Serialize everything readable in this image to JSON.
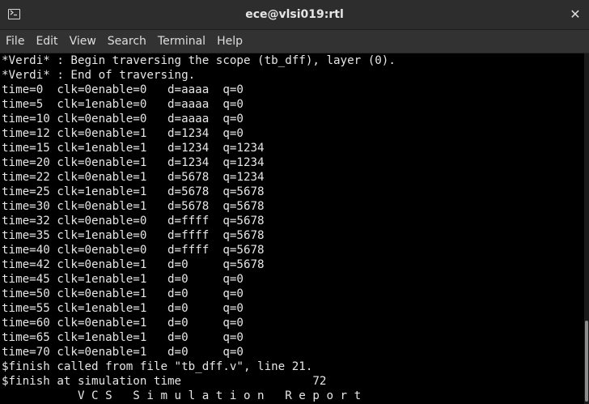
{
  "window": {
    "title": "ece@vlsi019:rtl",
    "close_glyph": "✕"
  },
  "icons": {
    "app": "terminal-icon",
    "close": "close-icon"
  },
  "menu": [
    {
      "label": "File"
    },
    {
      "label": "Edit"
    },
    {
      "label": "View"
    },
    {
      "label": "Search"
    },
    {
      "label": "Terminal"
    },
    {
      "label": "Help"
    }
  ],
  "terminal": {
    "lines": [
      "*Verdi* : Begin traversing the scope (tb_dff), layer (0).",
      "*Verdi* : End of traversing.",
      "time=0  clk=0enable=0   d=aaaa  q=0",
      "time=5  clk=1enable=0   d=aaaa  q=0",
      "time=10 clk=0enable=0   d=aaaa  q=0",
      "time=12 clk=0enable=1   d=1234  q=0",
      "time=15 clk=1enable=1   d=1234  q=1234",
      "time=20 clk=0enable=1   d=1234  q=1234",
      "time=22 clk=0enable=1   d=5678  q=1234",
      "time=25 clk=1enable=1   d=5678  q=5678",
      "time=30 clk=0enable=1   d=5678  q=5678",
      "time=32 clk=0enable=0   d=ffff  q=5678",
      "time=35 clk=1enable=0   d=ffff  q=5678",
      "time=40 clk=0enable=0   d=ffff  q=5678",
      "time=42 clk=0enable=1   d=0     q=5678",
      "time=45 clk=1enable=1   d=0     q=0",
      "time=50 clk=0enable=1   d=0     q=0",
      "time=55 clk=1enable=1   d=0     q=0",
      "time=60 clk=0enable=1   d=0     q=0",
      "time=65 clk=1enable=1   d=0     q=0",
      "time=70 clk=0enable=1   d=0     q=0",
      "$finish called from file \"tb_dff.v\", line 21.",
      "$finish at simulation time                   72",
      "           V C S   S i m u l a t i o n   R e p o r t"
    ]
  },
  "colors": {
    "titlebar_bg": "#2d2d2d",
    "menubar_bg": "#323232",
    "terminal_bg": "#000000",
    "terminal_fg": "#e6e6e6"
  }
}
